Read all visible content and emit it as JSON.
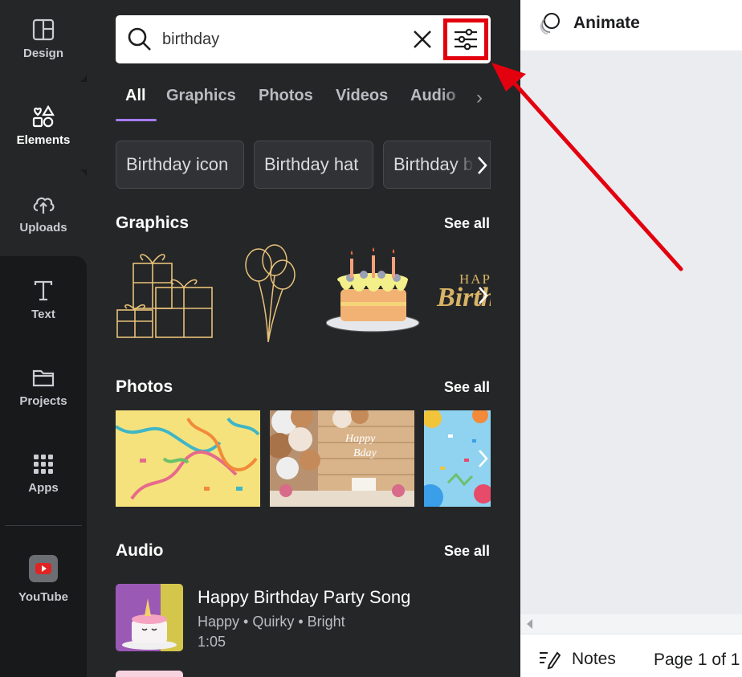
{
  "rail": {
    "items": [
      {
        "label": "Design",
        "icon": "layout-icon"
      },
      {
        "label": "Elements",
        "icon": "shapes-icon"
      },
      {
        "label": "Uploads",
        "icon": "cloud-upload-icon"
      },
      {
        "label": "Text",
        "icon": "text-icon"
      },
      {
        "label": "Projects",
        "icon": "folder-icon"
      },
      {
        "label": "Apps",
        "icon": "apps-grid-icon"
      },
      {
        "label": "YouTube",
        "icon": "youtube-icon"
      }
    ],
    "active": "Elements"
  },
  "search": {
    "value": "birthday",
    "icon_search": "search-icon",
    "icon_clear": "close-icon",
    "icon_filter": "filter-sliders-icon",
    "highlight_color": "#e3000f"
  },
  "tabs": [
    "All",
    "Graphics",
    "Photos",
    "Videos",
    "Audio"
  ],
  "active_tab": "All",
  "accent": "#a57bff",
  "chips": [
    "Birthday icon",
    "Birthday hat",
    "Birthday balloon"
  ],
  "sections": {
    "graphics": {
      "title": "Graphics",
      "see_all": "See all"
    },
    "photos": {
      "title": "Photos",
      "see_all": "See all"
    },
    "audio": {
      "title": "Audio",
      "see_all": "See all"
    }
  },
  "graphic_text": {
    "hap": "HAP",
    "birth": "Birth"
  },
  "photo_text": {
    "happy": "Happy",
    "bday": "Bday"
  },
  "audio": {
    "title": "Happy Birthday Party Song",
    "tags": "Happy • Quirky • Bright",
    "duration": "1:05"
  },
  "topbar": {
    "animate": "Animate"
  },
  "bottombar": {
    "notes": "Notes",
    "page": "Page 1 of 1"
  },
  "annotation_color": "#e3000f"
}
